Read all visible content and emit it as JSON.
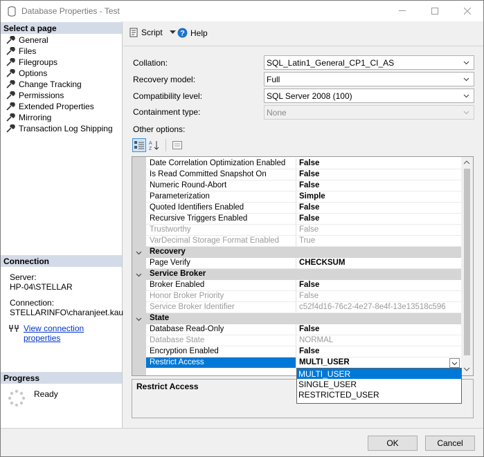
{
  "window": {
    "title": "Database Properties - Test"
  },
  "left": {
    "select_page_header": "Select a page",
    "pages": [
      "General",
      "Files",
      "Filegroups",
      "Options",
      "Change Tracking",
      "Permissions",
      "Extended Properties",
      "Mirroring",
      "Transaction Log Shipping"
    ],
    "connection_header": "Connection",
    "server_label": "Server:",
    "server_value": "HP-04\\STELLAR",
    "connection_label": "Connection:",
    "connection_value": "STELLARINFO\\charanjeet.kaur",
    "view_connection_link": "View connection properties",
    "progress_header": "Progress",
    "progress_status": "Ready"
  },
  "toolbar": {
    "script_label": "Script",
    "help_label": "Help"
  },
  "props": {
    "collation_label": "Collation:",
    "collation_value": "SQL_Latin1_General_CP1_CI_AS",
    "recovery_label": "Recovery model:",
    "recovery_value": "Full",
    "compat_label": "Compatibility level:",
    "compat_value": "SQL Server 2008 (100)",
    "containment_label": "Containment type:",
    "containment_value": "None",
    "other_options_label": "Other options:"
  },
  "grid": {
    "rows": [
      {
        "name": "Date Correlation Optimization Enabled",
        "value": "False"
      },
      {
        "name": "Is Read Committed Snapshot On",
        "value": "False"
      },
      {
        "name": "Numeric Round-Abort",
        "value": "False"
      },
      {
        "name": "Parameterization",
        "value": "Simple"
      },
      {
        "name": "Quoted Identifiers Enabled",
        "value": "False"
      },
      {
        "name": "Recursive Triggers Enabled",
        "value": "False"
      },
      {
        "name": "Trustworthy",
        "value": "False"
      },
      {
        "name": "VarDecimal Storage Format Enabled",
        "value": "True"
      },
      {
        "name": "Recovery",
        "value": ""
      },
      {
        "name": "Page Verify",
        "value": "CHECKSUM"
      },
      {
        "name": "Service Broker",
        "value": ""
      },
      {
        "name": "Broker Enabled",
        "value": "False"
      },
      {
        "name": "Honor Broker Priority",
        "value": "False"
      },
      {
        "name": "Service Broker Identifier",
        "value": "c52f4d16-76c2-4e27-8e4f-13e13518c596"
      },
      {
        "name": "State",
        "value": ""
      },
      {
        "name": "Database Read-Only",
        "value": "False"
      },
      {
        "name": "Database State",
        "value": "NORMAL"
      },
      {
        "name": "Encryption Enabled",
        "value": "False"
      },
      {
        "name": "Restrict Access",
        "value": "MULTI_USER"
      }
    ]
  },
  "description": {
    "title": "Restrict Access"
  },
  "dropdown": {
    "options": [
      "MULTI_USER",
      "SINGLE_USER",
      "RESTRICTED_USER"
    ]
  },
  "buttons": {
    "ok": "OK",
    "cancel": "Cancel"
  }
}
